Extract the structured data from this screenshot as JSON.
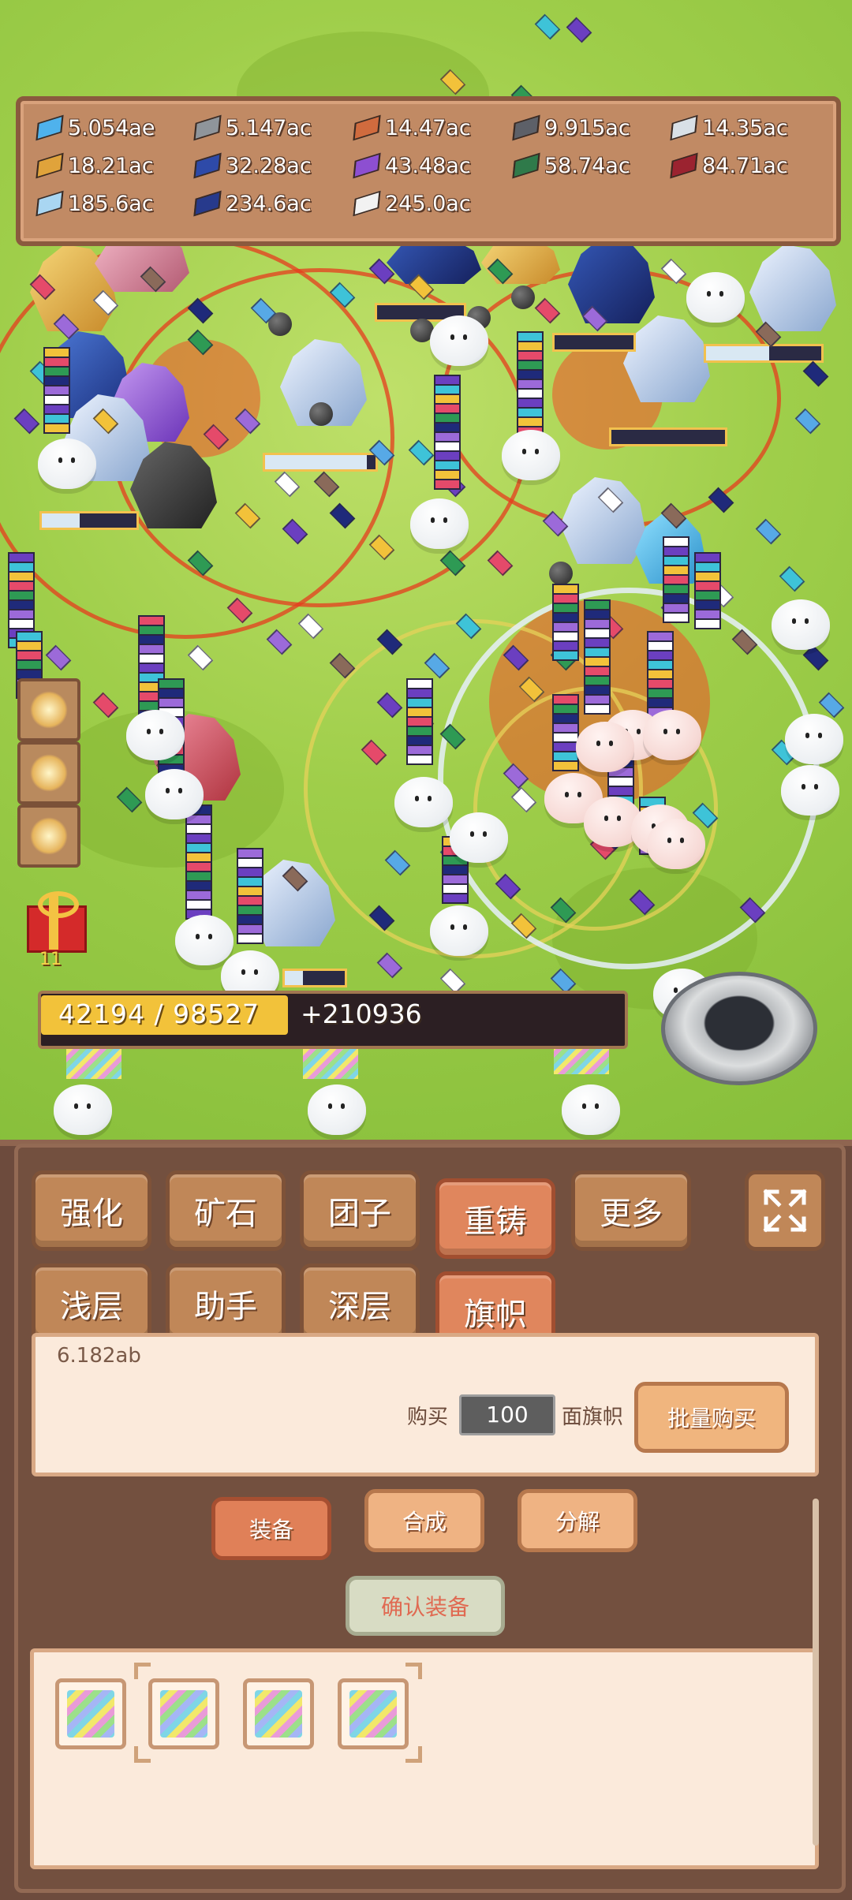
{
  "resources": [
    {
      "icon": "blue-diamond-icon",
      "color": "#4fb2ec",
      "value": "5.054ae"
    },
    {
      "icon": "iron-ingot-icon",
      "color": "#8f959b",
      "value": "5.147ac"
    },
    {
      "icon": "copper-ingot-icon",
      "color": "#d06b3e",
      "value": "14.47ac"
    },
    {
      "icon": "dark-ingot-icon",
      "color": "#5d6068",
      "value": "9.915ac"
    },
    {
      "icon": "silver-ingot-icon",
      "color": "#d9e0e6",
      "value": "14.35ac"
    },
    {
      "icon": "gold-ingot-icon",
      "color": "#e0a33b",
      "value": "18.21ac"
    },
    {
      "icon": "sapphire-ingot-icon",
      "color": "#2e4aa8",
      "value": "32.28ac"
    },
    {
      "icon": "amethyst-ingot-icon",
      "color": "#8d4fd1",
      "value": "43.48ac"
    },
    {
      "icon": "emerald-ingot-icon",
      "color": "#2f7a4a",
      "value": "58.74ac"
    },
    {
      "icon": "ruby-ingot-icon",
      "color": "#9b2330",
      "value": "84.71ac"
    },
    {
      "icon": "ice-ingot-icon",
      "color": "#a9d6f2",
      "value": "185.6ac"
    },
    {
      "icon": "navy-ingot-icon",
      "color": "#273a8c",
      "value": "234.6ac"
    },
    {
      "icon": "white-ingot-icon",
      "color": "#f2f2f2",
      "value": "245.0ac"
    }
  ],
  "gift": {
    "count": "11"
  },
  "progress": {
    "current_total": "42194 / 98527",
    "bonus": "+210936",
    "fraction": 0.428
  },
  "tabs_row1": [
    {
      "label": "强化",
      "active": false
    },
    {
      "label": "矿石",
      "active": false
    },
    {
      "label": "团子",
      "active": false
    },
    {
      "label": "重铸",
      "active": true
    },
    {
      "label": "更多",
      "active": false
    }
  ],
  "tabs_row2": [
    {
      "label": "浅层",
      "active": false
    },
    {
      "label": "助手",
      "active": false
    },
    {
      "label": "深层",
      "active": false
    },
    {
      "label": "旗帜",
      "active": true
    }
  ],
  "shop": {
    "partial_value": "6.182ab",
    "buy_label": "购买",
    "quantity": "100",
    "unit_label": "面旗帜",
    "bulk_buy": "批量购买"
  },
  "actions": {
    "equip": "装备",
    "combine": "合成",
    "decompose": "分解",
    "confirm": "确认装备"
  },
  "colors": {
    "panel_bg": "#6d4b3d",
    "tab": "#c08758",
    "tab_active": "#e0865d",
    "progress_fill": "#f2c23a"
  }
}
